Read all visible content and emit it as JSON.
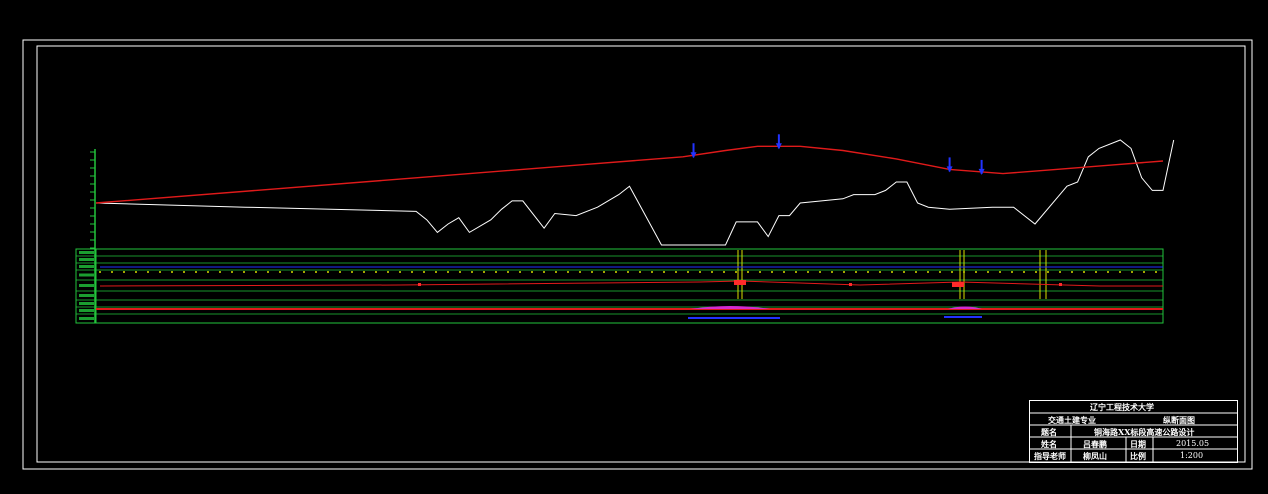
{
  "colors": {
    "background": "#000000",
    "frame": "#ffffff",
    "ground_line": "#ffffff",
    "design_line": "#e01a1a",
    "axis": "#22c53c",
    "table_lines": "#d8e000",
    "table_border": "#22c53c",
    "markers": "#2233ff",
    "curve_marks": "#ff2a2a",
    "super_marks": "#d12bd1"
  },
  "icons": {
    "structure_marker": "arrow-down-icon",
    "curve_element": "curve-element-icon"
  },
  "title_block": {
    "university": "辽宁工程技术大学",
    "major": "交通土建专业",
    "drawing_name": "纵断面图",
    "title_label": "题名",
    "title_value": "铜海路XX标段高速公路设计",
    "name_label": "姓名",
    "name_value": "吕春鹏",
    "date_label": "日期",
    "date_value": "2015.05",
    "advisor_label": "指导老师",
    "advisor_value": "柳凤山",
    "scale_label": "比例",
    "scale_value": "1:200"
  },
  "chart_data": {
    "type": "line",
    "ground_profile": [
      [
        0,
        50
      ],
      [
        14,
        48
      ],
      [
        30,
        46
      ],
      [
        31,
        42
      ],
      [
        32,
        36
      ],
      [
        33,
        40
      ],
      [
        34,
        43
      ],
      [
        35,
        36
      ],
      [
        37,
        42
      ],
      [
        38,
        47
      ],
      [
        39,
        51
      ],
      [
        40,
        51
      ],
      [
        42,
        38
      ],
      [
        43,
        45
      ],
      [
        45,
        44
      ],
      [
        47,
        48
      ],
      [
        49,
        54
      ],
      [
        50,
        58
      ],
      [
        53,
        30
      ],
      [
        55,
        30
      ],
      [
        57,
        30
      ],
      [
        59,
        30
      ],
      [
        60,
        41
      ],
      [
        62,
        41
      ],
      [
        63,
        34
      ],
      [
        64,
        44
      ],
      [
        65,
        44
      ],
      [
        66,
        50
      ],
      [
        68,
        51
      ],
      [
        70,
        52
      ],
      [
        71,
        54
      ],
      [
        73,
        54
      ],
      [
        74,
        56
      ],
      [
        75,
        60
      ],
      [
        76,
        60
      ],
      [
        77,
        50
      ],
      [
        78,
        48
      ],
      [
        80,
        47
      ],
      [
        84,
        48
      ],
      [
        86,
        48
      ],
      [
        88,
        40
      ],
      [
        90,
        52
      ],
      [
        91,
        58
      ],
      [
        92,
        60
      ],
      [
        93,
        72
      ],
      [
        94,
        76
      ],
      [
        96,
        80
      ],
      [
        97,
        76
      ],
      [
        98,
        62
      ],
      [
        99,
        56
      ],
      [
        100,
        56
      ],
      [
        101,
        80
      ]
    ],
    "design_line": [
      [
        0,
        50
      ],
      [
        15,
        56
      ],
      [
        30,
        62
      ],
      [
        45,
        68
      ],
      [
        55,
        72
      ],
      [
        59,
        75
      ],
      [
        62,
        77
      ],
      [
        66,
        77
      ],
      [
        70,
        75
      ],
      [
        75,
        71
      ],
      [
        80,
        66
      ],
      [
        85,
        64
      ],
      [
        90,
        66
      ],
      [
        95,
        68
      ],
      [
        100,
        70
      ]
    ],
    "structure_marks": [
      56,
      64,
      80,
      83
    ]
  }
}
